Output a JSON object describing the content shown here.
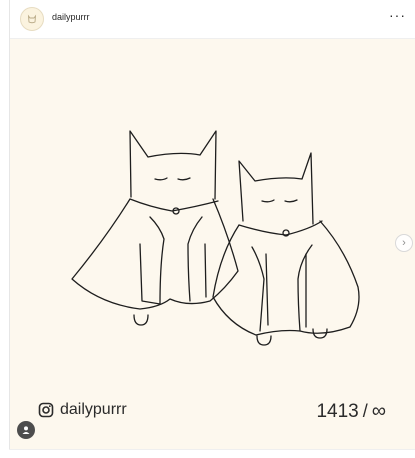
{
  "post": {
    "username": "dailypurrr",
    "more_label": "···"
  },
  "image": {
    "next_label": "›",
    "brand_label": "dailypurrr",
    "counter": {
      "current": "1413",
      "separator": "/",
      "total": "∞"
    }
  },
  "icons": {
    "avatar": "cat-face-logo-icon",
    "brand": "instagram-icon",
    "next": "chevron-right-icon",
    "profile": "user-avatar-icon"
  },
  "colors": {
    "image_background": "#fdf8ee",
    "line_art": "#1e1e1e",
    "text": "#262626"
  }
}
